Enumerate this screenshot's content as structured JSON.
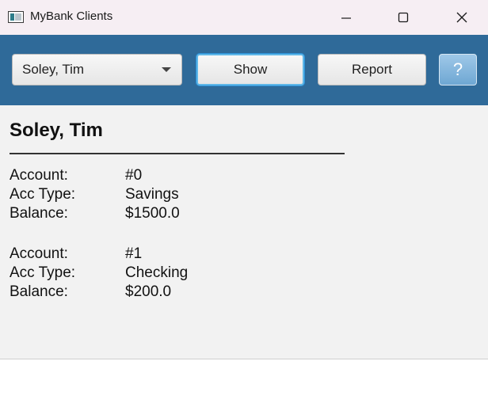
{
  "window": {
    "title": "MyBank Clients",
    "controls": {
      "minimize": "—",
      "maximize": "☐",
      "close": "✕"
    }
  },
  "toolbar": {
    "client_select_value": "Soley, Tim",
    "show_label": "Show",
    "report_label": "Report",
    "help_label": "?"
  },
  "client": {
    "name": "Soley, Tim",
    "accounts": [
      {
        "account_label": "Account:",
        "account_value": "#0",
        "type_label": "Acc Type:",
        "type_value": "Savings",
        "balance_label": "Balance:",
        "balance_value": "$1500.0"
      },
      {
        "account_label": "Account:",
        "account_value": "#1",
        "type_label": "Acc Type:",
        "type_value": "Checking",
        "balance_label": "Balance:",
        "balance_value": "$200.0"
      }
    ]
  },
  "colors": {
    "toolbar_bg": "#2f6a99",
    "titlebar_bg": "#f6eef3",
    "content_bg": "#f2f2f2",
    "focus_ring": "#2a8fd6"
  }
}
